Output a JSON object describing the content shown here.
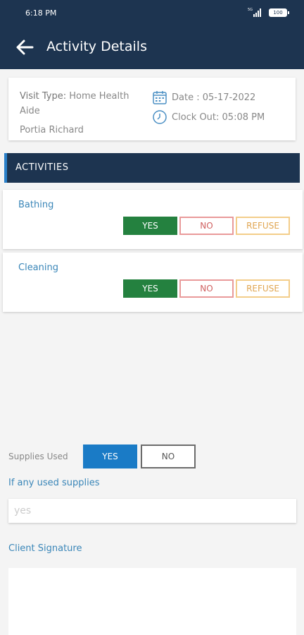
{
  "status_bar": {
    "time": "6:18 PM",
    "battery": "100"
  },
  "header": {
    "title": "Activity Details"
  },
  "visit": {
    "type_label": "Visit Type:",
    "type_value": "Home Health Aide",
    "client_name": "Portia Richard",
    "date": "Date : 05-17-2022",
    "clock_out": "Clock Out:  05:08 PM"
  },
  "activities_header": "ACTIVITIES",
  "activities": [
    {
      "name": "Bathing",
      "selected": "yes"
    },
    {
      "name": "Cleaning",
      "selected": "yes"
    }
  ],
  "buttons": {
    "yes": "YES",
    "no": "NO",
    "refuse": "REFUSE"
  },
  "supplies": {
    "label": "Supplies Used",
    "yes": "YES",
    "no": "NO",
    "selected": "yes",
    "prompt": "If any used supplies",
    "value": "yes"
  },
  "signature": {
    "label": "Client Signature"
  },
  "colors": {
    "header_bg": "#1d3450",
    "yes_selected": "#24813f",
    "no_border": "#e99a9a",
    "refuse_border": "#f3cd8a",
    "supplies_yes": "#1a7bc6",
    "link_text": "#3a86b8"
  }
}
